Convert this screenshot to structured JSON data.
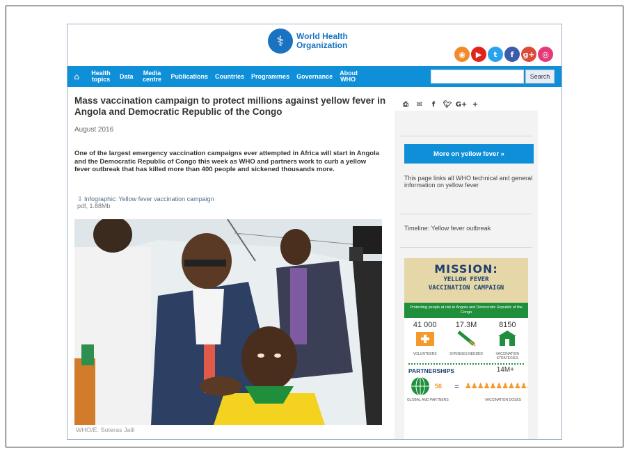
{
  "header": {
    "org_name_line1": "World Health",
    "org_name_line2": "Organization",
    "social_icons": [
      "rss-icon",
      "youtube-icon",
      "twitter-icon",
      "facebook-icon",
      "googleplus-icon",
      "instagram-icon"
    ]
  },
  "nav": {
    "items": [
      {
        "label": "Health topics",
        "line1": "Health",
        "line2": "topics"
      },
      {
        "label": "Data"
      },
      {
        "label": "Media centre",
        "line1": "Media",
        "line2": "centre"
      },
      {
        "label": "Publications"
      },
      {
        "label": "Countries"
      },
      {
        "label": "Programmes"
      },
      {
        "label": "Governance"
      },
      {
        "label": "About WHO",
        "line1": "About",
        "line2": "WHO"
      }
    ],
    "search_placeholder": "",
    "search_button": "Search"
  },
  "article": {
    "title": "Mass vaccination campaign to protect millions against yellow fever in Angola and Democratic Republic of the Congo",
    "date": "August 2016",
    "lead": "One of the largest emergency vaccination campaigns ever attempted in Africa will start in Angola and the Democratic Republic of Congo this week as WHO and partners work to curb a yellow fever outbreak that has killed more than 400 people and sickened thousands more.",
    "infographic_link": "Infographic: Yellow fever vaccination campaign",
    "infographic_meta": "pdf, 1.88Mb",
    "photo_caption": "WHO/E. Soteras Jalil"
  },
  "share_icons": [
    "print-icon",
    "email-icon",
    "facebook-icon",
    "twitter-icon",
    "googleplus-icon",
    "plus-icon"
  ],
  "sidebar": {
    "more_button": "More on yellow fever »",
    "links_text": "This page links all WHO technical and general information on yellow fever",
    "timeline_link": "Timeline: Yellow fever outbreak"
  },
  "poster": {
    "mission": "MISSION:",
    "line1": "YELLOW FEVER",
    "line2": "VACCINATION CAMPAIGN",
    "green_line": "Protecting people at risk in Angola and Democratic Republic of the Congo",
    "stats": [
      {
        "value": "41 000",
        "label": "VOLUNTEERS"
      },
      {
        "value": "17.3M",
        "label": "SYRINGES NEEDED"
      },
      {
        "value": "8150",
        "label": "VACCINATION STRATEGIES"
      }
    ],
    "partnerships_title": "PARTNERSHIPS",
    "partners_count": "56",
    "doses": "14M+",
    "partners_label": "GLOBAL AND PARTNERS",
    "doses_label": "VACCINATION DOSES"
  },
  "colors": {
    "nav_bg": "#0f8fd8",
    "brand": "#1a73c1",
    "campaign_green": "#1f8f3c",
    "campaign_orange": "#f39a2b"
  }
}
